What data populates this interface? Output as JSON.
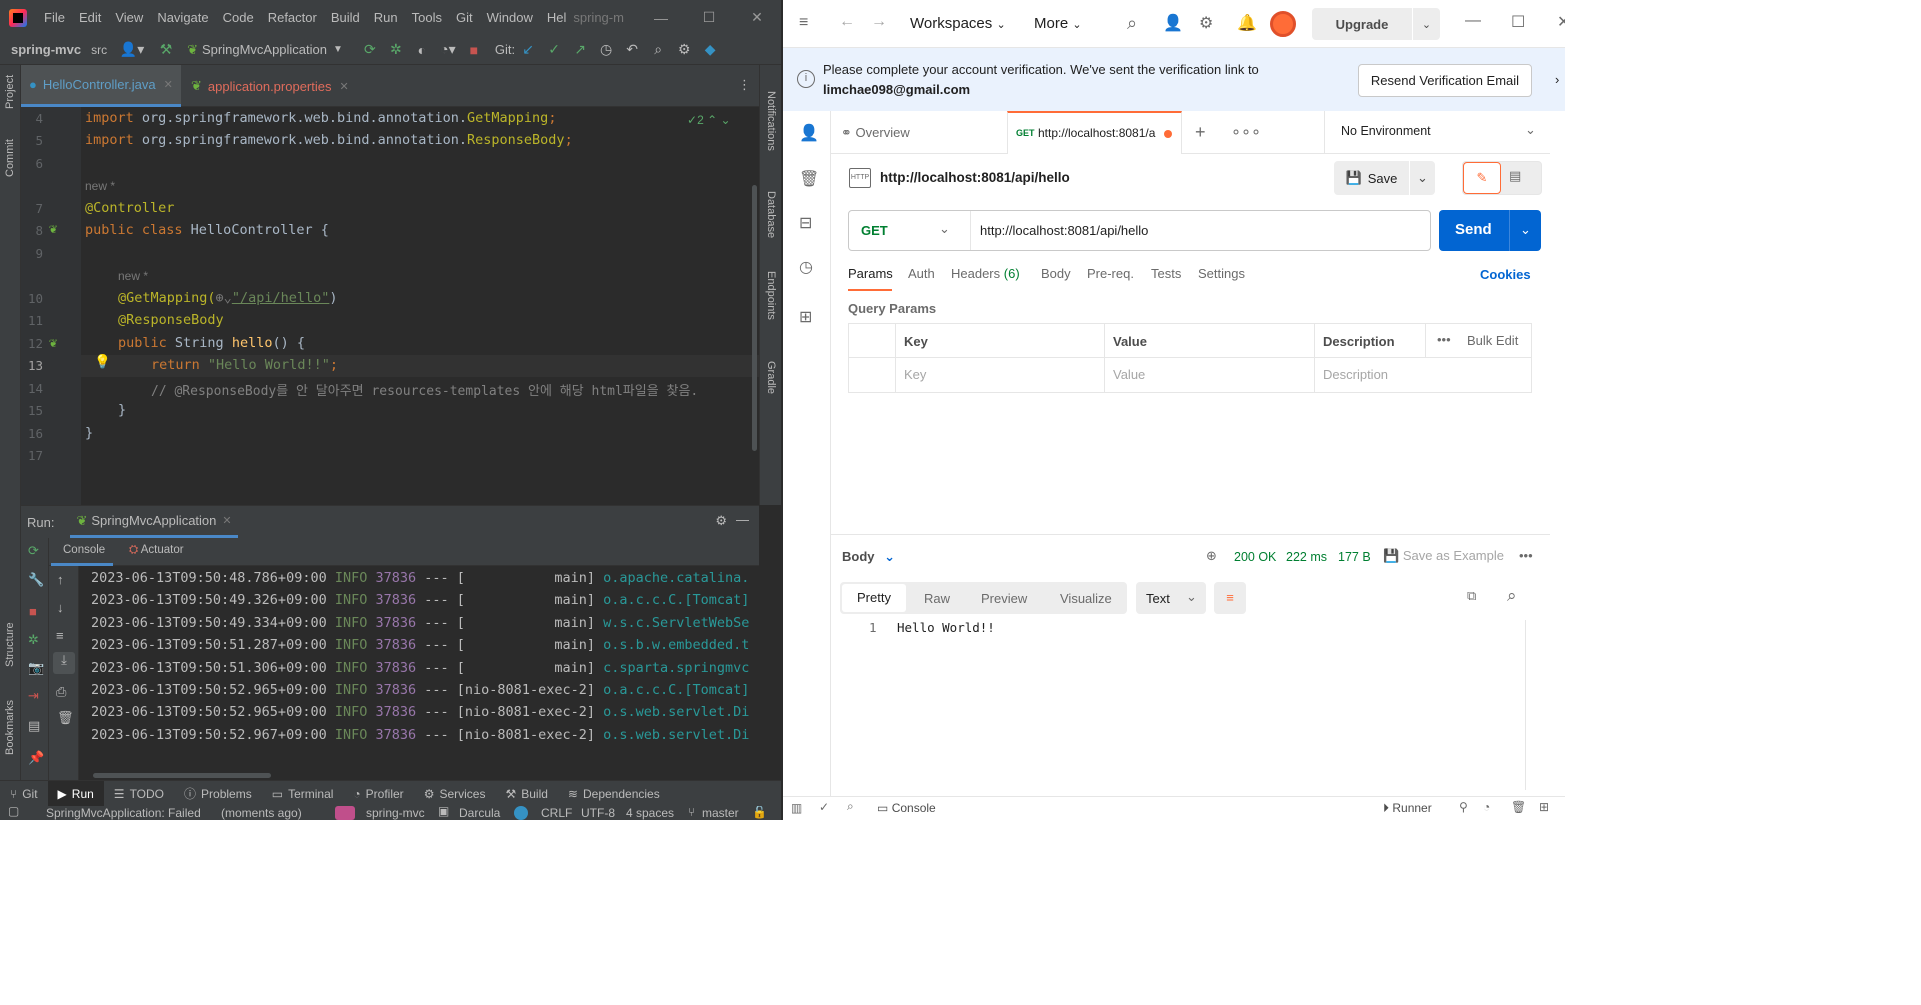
{
  "intellij": {
    "menu": [
      "File",
      "Edit",
      "View",
      "Navigate",
      "Code",
      "Refactor",
      "Build",
      "Run",
      "Tools",
      "Git",
      "Window",
      "Hel"
    ],
    "window_title": "spring-m",
    "breadcrumb": {
      "project": "spring-mvc",
      "folder": "src"
    },
    "run_config": "SpringMvcApplication",
    "git_label": "Git:",
    "left_strip": {
      "project": "Project",
      "commit": "Commit",
      "structure": "Structure",
      "bookmarks": "Bookmarks"
    },
    "right_strip": {
      "notifications": "Notifications",
      "database": "Database",
      "endpoints": "Endpoints",
      "gradle": "Gradle"
    },
    "editor_tabs": [
      {
        "label": "HelloController.java"
      },
      {
        "label": "application.properties"
      }
    ],
    "inspection_count": "2",
    "code": {
      "lines": [
        "4",
        "5",
        "6",
        "7",
        "8",
        "9",
        "10",
        "11",
        "12",
        "13",
        "14",
        "15",
        "16",
        "17"
      ],
      "l4_kw": "import",
      "l4_pkg": " org.springframework.web.bind.annotation.",
      "l4_cls": "GetMapping",
      "l4_end": ";",
      "l5_kw": "import",
      "l5_pkg": " org.springframework.web.bind.annotation.",
      "l5_cls": "ResponseBody",
      "l5_end": ";",
      "hint1": "new *",
      "l7": "@Controller",
      "l8_kw": "public class",
      "l8_name": " HelloController {",
      "hint2": "new *",
      "l10_ann": "@GetMapping(",
      "l10_str": "\"/api/hello\"",
      "l10_end": ")",
      "l11": "@ResponseBody",
      "l12_kw": "public",
      "l12_type": " String ",
      "l12_fn": "hello",
      "l12_end": "() {",
      "l13_kw": "return",
      "l13_str": " \"Hello World!!\"",
      "l13_end": ";",
      "l14": "// @ResponseBody를 안 달아주면 resources-templates 안에 해당 html파일을 찾음.",
      "l15": "}",
      "l16": "}"
    },
    "run_panel": {
      "label": "Run:",
      "config": "SpringMvcApplication",
      "tabs": [
        "Console",
        "Actuator"
      ],
      "logs": [
        {
          "ts": "2023-06-13T09:50:48.786+09:00",
          "level": "INFO",
          "pid": "37836",
          "thread": "--- [           main]",
          "cls": "o.apache.catalina."
        },
        {
          "ts": "2023-06-13T09:50:49.326+09:00",
          "level": "INFO",
          "pid": "37836",
          "thread": "--- [           main]",
          "cls": "o.a.c.c.C.[Tomcat]"
        },
        {
          "ts": "2023-06-13T09:50:49.334+09:00",
          "level": "INFO",
          "pid": "37836",
          "thread": "--- [           main]",
          "cls": "w.s.c.ServletWebSe"
        },
        {
          "ts": "2023-06-13T09:50:51.287+09:00",
          "level": "INFO",
          "pid": "37836",
          "thread": "--- [           main]",
          "cls": "o.s.b.w.embedded.t"
        },
        {
          "ts": "2023-06-13T09:50:51.306+09:00",
          "level": "INFO",
          "pid": "37836",
          "thread": "--- [           main]",
          "cls": "c.sparta.springmvc"
        },
        {
          "ts": "2023-06-13T09:50:52.965+09:00",
          "level": "INFO",
          "pid": "37836",
          "thread": "--- [nio-8081-exec-2]",
          "cls": "o.a.c.c.C.[Tomcat]"
        },
        {
          "ts": "2023-06-13T09:50:52.965+09:00",
          "level": "INFO",
          "pid": "37836",
          "thread": "--- [nio-8081-exec-2]",
          "cls": "o.s.web.servlet.Di"
        },
        {
          "ts": "2023-06-13T09:50:52.967+09:00",
          "level": "INFO",
          "pid": "37836",
          "thread": "--- [nio-8081-exec-2]",
          "cls": "o.s.web.servlet.Di"
        }
      ]
    },
    "bottom_tabs": [
      "Git",
      "Run",
      "TODO",
      "Problems",
      "Terminal",
      "Profiler",
      "Services",
      "Build",
      "Dependencies"
    ],
    "status": {
      "message": "SpringMvcApplication: Failed",
      "time": "(moments ago)",
      "project": "spring-mvc",
      "theme": "Darcula",
      "line_sep": "CRLF",
      "encoding": "UTF-8",
      "indent": "4 spaces",
      "branch": "master"
    },
    "colors": {
      "bg": "#2b2b2b",
      "panel": "#3c3f41",
      "keyword": "#cc7832",
      "string": "#6a8759",
      "annotation": "#bbb529"
    }
  },
  "postman": {
    "nav": {
      "workspaces": "Workspaces",
      "more": "More",
      "upgrade": "Upgrade"
    },
    "banner": {
      "text": "Please complete your account verification. We've sent the verification link to",
      "email": "limchae098@gmail.com",
      "button": "Resend Verification Email"
    },
    "tabs": {
      "overview": "Overview",
      "request_method": "GET",
      "request_url": "http://localhost:8081/a",
      "environment": "No Environment"
    },
    "request": {
      "title": "http://localhost:8081/api/hello",
      "save": "Save",
      "method": "GET",
      "url": "http://localhost:8081/api/hello",
      "send": "Send",
      "subtabs": [
        "Params",
        "Auth",
        "Headers",
        "(6)",
        "Body",
        "Pre-req.",
        "Tests",
        "Settings"
      ],
      "cookies": "Cookies",
      "query_params": "Query Params",
      "table_headers": [
        "Key",
        "Value",
        "Description"
      ],
      "bulk_edit": "Bulk Edit",
      "placeholders": [
        "Key",
        "Value",
        "Description"
      ]
    },
    "response": {
      "body_label": "Body",
      "status": "200 OK",
      "time": "222 ms",
      "size": "177 B",
      "save_example": "Save as Example",
      "views": [
        "Pretty",
        "Raw",
        "Preview",
        "Visualize"
      ],
      "format": "Text",
      "line_no": "1",
      "body": "Hello World!!"
    },
    "footer": {
      "console": "Console",
      "runner": "Runner"
    },
    "colors": {
      "accent": "#0265d2",
      "orange": "#ff6c37",
      "status_ok": "#007f31"
    }
  }
}
